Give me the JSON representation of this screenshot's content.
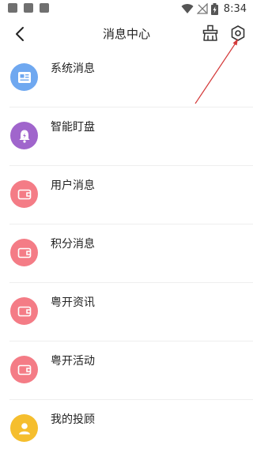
{
  "status_bar": {
    "time": "8:34",
    "icons": [
      "notification-square-icon",
      "notification-square-icon",
      "notification-square-icon",
      "wifi-icon",
      "no-signal-icon",
      "battery-charging-icon"
    ]
  },
  "header": {
    "title": "消息中心",
    "back_icon": "chevron-left-icon",
    "clean_icon": "broom-icon",
    "settings_icon": "hexagon-settings-icon"
  },
  "messages": [
    {
      "label": "系统消息",
      "icon": "news-icon",
      "color": "#6FA8F0"
    },
    {
      "label": "智能盯盘",
      "icon": "bell-icon",
      "color": "#A065CC"
    },
    {
      "label": "用户消息",
      "icon": "wallet-icon",
      "color": "#F47C86"
    },
    {
      "label": "积分消息",
      "icon": "wallet-icon",
      "color": "#F47C86"
    },
    {
      "label": "粤开资讯",
      "icon": "wallet-icon",
      "color": "#F47C86"
    },
    {
      "label": "粤开活动",
      "icon": "wallet-icon",
      "color": "#F47C86"
    },
    {
      "label": "我的投顾",
      "icon": "person-icon",
      "color": "#F5BE2E"
    }
  ],
  "colors": {
    "annotation_arrow": "#D43A3A"
  }
}
